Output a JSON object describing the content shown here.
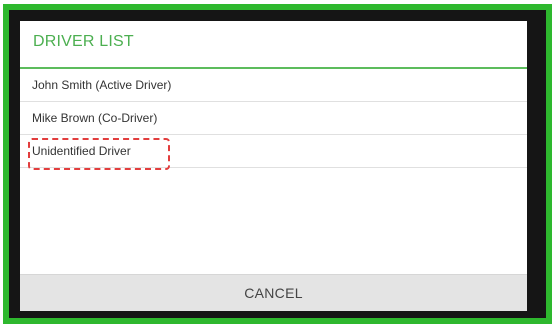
{
  "dialog": {
    "title": "DRIVER LIST",
    "items": [
      {
        "label": "John Smith (Active Driver)"
      },
      {
        "label": "Mike Brown (Co-Driver)"
      },
      {
        "label": "Unidentified Driver"
      }
    ],
    "cancel_label": "CANCEL"
  },
  "colors": {
    "frame": "#2eb82e",
    "title": "#4caf50",
    "header_rule": "#5cbc5c",
    "highlight": "#e23d3d",
    "footer": "#e4e4e4"
  }
}
